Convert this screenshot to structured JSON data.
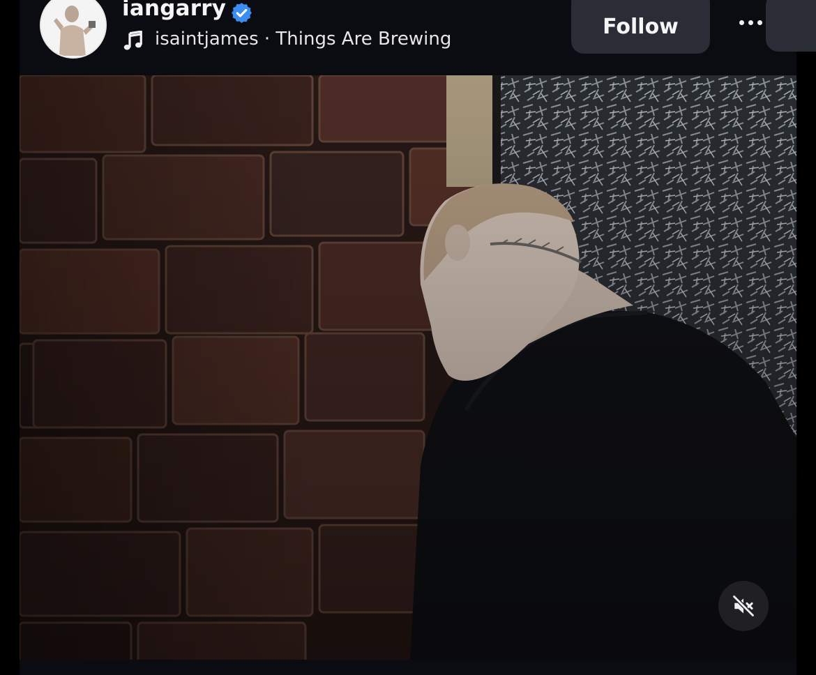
{
  "post": {
    "username": "iangarry",
    "verified": true,
    "audio_artist": "isaintjames",
    "audio_separator": "·",
    "audio_title": "Things Are Brewing",
    "follow_label": "Follow"
  },
  "icons": {
    "verified": "verified-badge-icon",
    "music": "music-note-icon",
    "more": "more-options-icon",
    "mute": "speaker-muted-icon"
  },
  "colors": {
    "background": "#0b0c12",
    "button": "#2a2d35",
    "verified_blue": "#3b8df1",
    "text": "#f5f5f5"
  }
}
